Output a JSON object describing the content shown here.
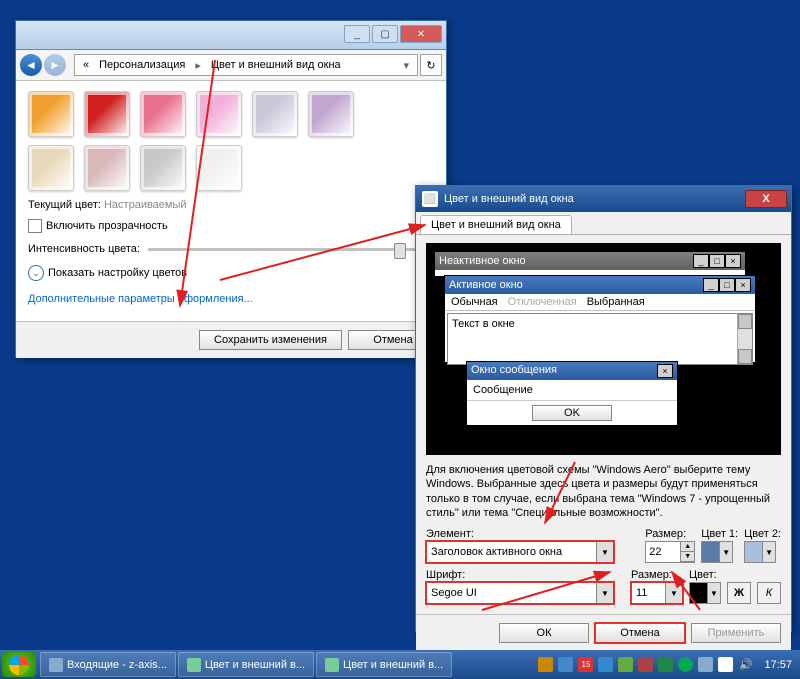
{
  "win1": {
    "breadcrumb_back": "«",
    "breadcrumb1": "Персонализация",
    "breadcrumb2": "Цвет и внешний вид окна",
    "swatches_row1": [
      "#f0a030",
      "#d02020",
      "#e87090",
      "#f0b0d8",
      "#c8c8d8",
      "#c0a8d0"
    ],
    "swatches_row2": [
      "#e8d8b8",
      "#d8b8b8",
      "#c8c8c8",
      "#f0f0f0"
    ],
    "current_label": "Текущий цвет:",
    "current_value": "Настраиваемый",
    "transparency": "Включить прозрачность",
    "intensity": "Интенсивность цвета:",
    "show_mixer": "Показать настройку цветов",
    "adv_link": "Дополнительные параметры оформления...",
    "save": "Сохранить изменения",
    "cancel": "Отмена"
  },
  "win2": {
    "title": "Цвет и внешний вид окна",
    "tab": "Цвет и внешний вид окна",
    "preview": {
      "inactive": "Неактивное окно",
      "active": "Активное окно",
      "menu_normal": "Обычная",
      "menu_disabled": "Отключенная",
      "menu_selected": "Выбранная",
      "text": "Текст в окне",
      "msg_title": "Окно сообщения",
      "msg_text": "Сообщение",
      "ok": "OK"
    },
    "desc": "Для включения цветовой схемы \"Windows Aero\" выберите тему Windows.  Выбранные здесь цвета и размеры будут применяться только в том случае, если выбрана тема \"Windows 7 - упрощенный стиль\" или тема \"Специальные возможности\".",
    "element_label": "Элемент:",
    "element_value": "Заголовок активного окна",
    "size_label": "Размер:",
    "size_value": "22",
    "color1_label": "Цвет 1:",
    "color1": "#5a7aa8",
    "color2_label": "Цвет 2:",
    "color2": "#a8c0e0",
    "font_label": "Шрифт:",
    "font_value": "Segoe UI",
    "fsize_label": "Размер:",
    "fsize_value": "11",
    "fcolor_label": "Цвет:",
    "fcolor": "#000000",
    "bold": "Ж",
    "italic": "К",
    "ok": "ОК",
    "cancel": "Отмена",
    "apply": "Применить"
  },
  "taskbar": {
    "btn1": "Входящие - z-axis...",
    "btn2": "Цвет и внешний в...",
    "btn3": "Цвет и внешний в...",
    "tray_badge": "15",
    "clock": "17:57"
  }
}
